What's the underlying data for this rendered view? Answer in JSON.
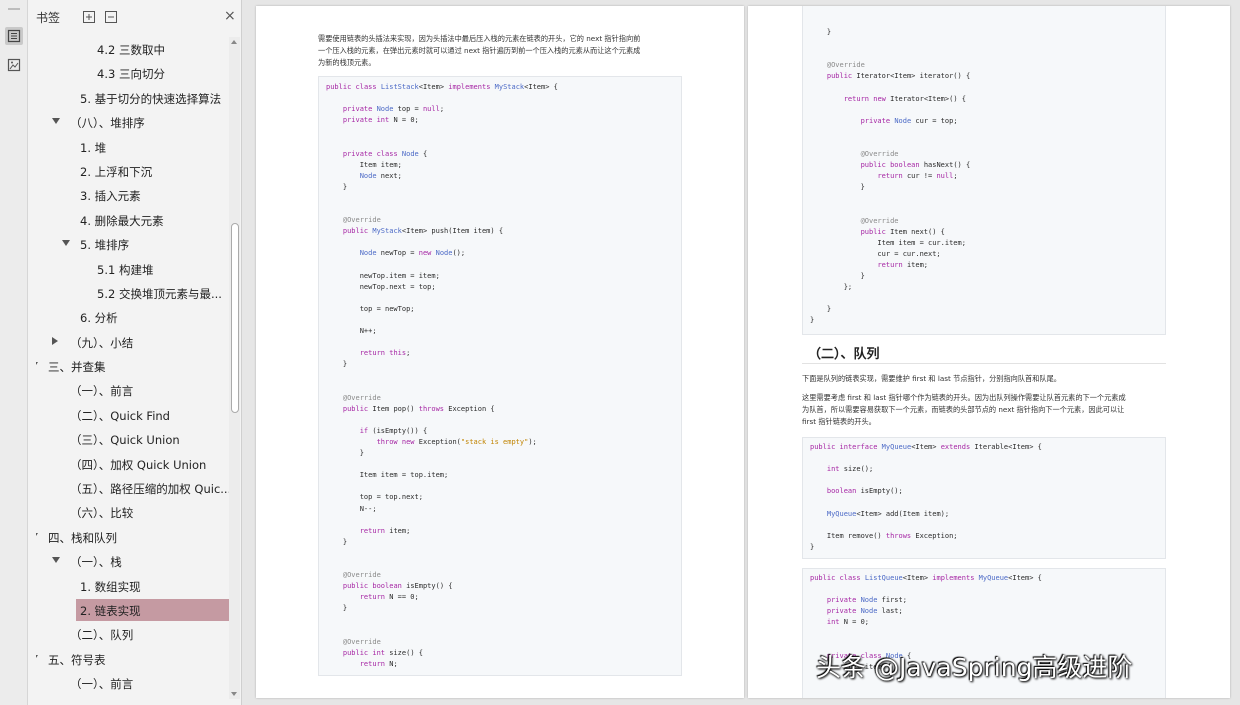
{
  "panel": {
    "title": "书签",
    "close_glyph": "×"
  },
  "bookmarks": [
    {
      "label": "4.2 三数取中",
      "level": 4,
      "arrow": "none"
    },
    {
      "label": "4.3 三向切分",
      "level": 4,
      "arrow": "none"
    },
    {
      "label": "5. 基于切分的快速选择算法",
      "level": 3,
      "arrow": "none"
    },
    {
      "label": "（八）、堆排序",
      "level": 2,
      "arrow": "down"
    },
    {
      "label": "1. 堆",
      "level": 3,
      "arrow": "none"
    },
    {
      "label": "2. 上浮和下沉",
      "level": 3,
      "arrow": "none"
    },
    {
      "label": "3. 插入元素",
      "level": 3,
      "arrow": "none"
    },
    {
      "label": "4. 删除最大元素",
      "level": 3,
      "arrow": "none"
    },
    {
      "label": "5. 堆排序",
      "level": 3,
      "arrow": "down"
    },
    {
      "label": "5.1 构建堆",
      "level": 4,
      "arrow": "none"
    },
    {
      "label": "5.2 交换堆顶元素与最...",
      "level": 4,
      "arrow": "none"
    },
    {
      "label": "6. 分析",
      "level": 3,
      "arrow": "none"
    },
    {
      "label": "（九）、小结",
      "level": 2,
      "arrow": "right"
    },
    {
      "label": "三、并查集",
      "level": 1,
      "arrow": "down"
    },
    {
      "label": "（一）、前言",
      "level": 2,
      "arrow": "none"
    },
    {
      "label": "（二）、Quick Find",
      "level": 2,
      "arrow": "none"
    },
    {
      "label": "（三）、Quick Union",
      "level": 2,
      "arrow": "none"
    },
    {
      "label": "（四）、加权 Quick Union",
      "level": 2,
      "arrow": "none"
    },
    {
      "label": "（五）、路径压缩的加权 Quic...",
      "level": 2,
      "arrow": "none"
    },
    {
      "label": "（六）、比较",
      "level": 2,
      "arrow": "none"
    },
    {
      "label": "四、栈和队列",
      "level": 1,
      "arrow": "down"
    },
    {
      "label": "（一）、栈",
      "level": 2,
      "arrow": "down"
    },
    {
      "label": "1. 数组实现",
      "level": 3,
      "arrow": "none"
    },
    {
      "label": "2. 链表实现",
      "level": 3,
      "arrow": "none",
      "selected": true
    },
    {
      "label": "（二）、队列",
      "level": 2,
      "arrow": "none"
    },
    {
      "label": "五、符号表",
      "level": 1,
      "arrow": "down"
    },
    {
      "label": "（一）、前言",
      "level": 2,
      "arrow": "none"
    }
  ],
  "page_left": {
    "intro": [
      "需要使用链表的头插法来实现，因为头插法中最后压入栈的元素在链表的开头，它的 next 指针指向前",
      "一个压入栈的元素，在弹出元素时就可以通过 next 指针遍历到前一个压入栈的元素从而让这个元素成",
      "为新的栈顶元素。"
    ],
    "code": [
      "public class ListStack<Item> implements MyStack<Item> {",
      "",
      "    private Node top = null;",
      "    private int N = 0;",
      "",
      "",
      "    private class Node {",
      "        Item item;",
      "        Node next;",
      "    }",
      "",
      "",
      "    @Override",
      "    public MyStack<Item> push(Item item) {",
      "",
      "        Node newTop = new Node();",
      "",
      "        newTop.item = item;",
      "        newTop.next = top;",
      "",
      "        top = newTop;",
      "",
      "        N++;",
      "",
      "        return this;",
      "    }",
      "",
      "",
      "    @Override",
      "    public Item pop() throws Exception {",
      "",
      "        if (isEmpty()) {",
      "            throw new Exception(\"stack is empty\");",
      "        }",
      "",
      "        Item item = top.item;",
      "",
      "        top = top.next;",
      "        N--;",
      "",
      "        return item;",
      "    }",
      "",
      "",
      "    @Override",
      "    public boolean isEmpty() {",
      "        return N == 0;",
      "    }",
      "",
      "",
      "    @Override",
      "    public int size() {",
      "        return N;"
    ]
  },
  "page_right": {
    "code_top": [
      "    }",
      "",
      "",
      "    @Override",
      "    public Iterator<Item> iterator() {",
      "",
      "        return new Iterator<Item>() {",
      "",
      "            private Node cur = top;",
      "",
      "",
      "            @Override",
      "            public boolean hasNext() {",
      "                return cur != null;",
      "            }",
      "",
      "",
      "            @Override",
      "            public Item next() {",
      "                Item item = cur.item;",
      "                cur = cur.next;",
      "                return item;",
      "            }",
      "        };",
      "",
      "    }",
      "}"
    ],
    "heading": "（二）、队列",
    "para1": "下面是队列的链表实现，需要维护 first 和 last 节点指针，分别指向队首和队尾。",
    "para2": [
      "这里需要考虑 first 和 last 指针哪个作为链表的开头。因为出队列操作需要让队首元素的下一个元素成",
      "为队首，所以需要容易获取下一个元素，而链表的头部节点的 next 指针指向下一个元素，因此可以让",
      "first 指针链表的开头。"
    ],
    "code_iface": [
      "public interface MyQueue<Item> extends Iterable<Item> {",
      "",
      "    int size();",
      "",
      "    boolean isEmpty();",
      "",
      "    MyQueue<Item> add(Item item);",
      "",
      "    Item remove() throws Exception;",
      "}"
    ],
    "code_list": [
      "public class ListQueue<Item> implements MyQueue<Item> {",
      "",
      "    private Node first;",
      "    private Node last;",
      "    int N = 0;",
      "",
      "",
      "    private class Node {",
      "        Item item;"
    ]
  },
  "watermark": "头条 @JavaSpring高级进阶",
  "colors": {
    "selected_bookmark": "#c59aa2",
    "keyword": "#a626a4",
    "type": "#4b69c6",
    "string": "#c18401"
  }
}
